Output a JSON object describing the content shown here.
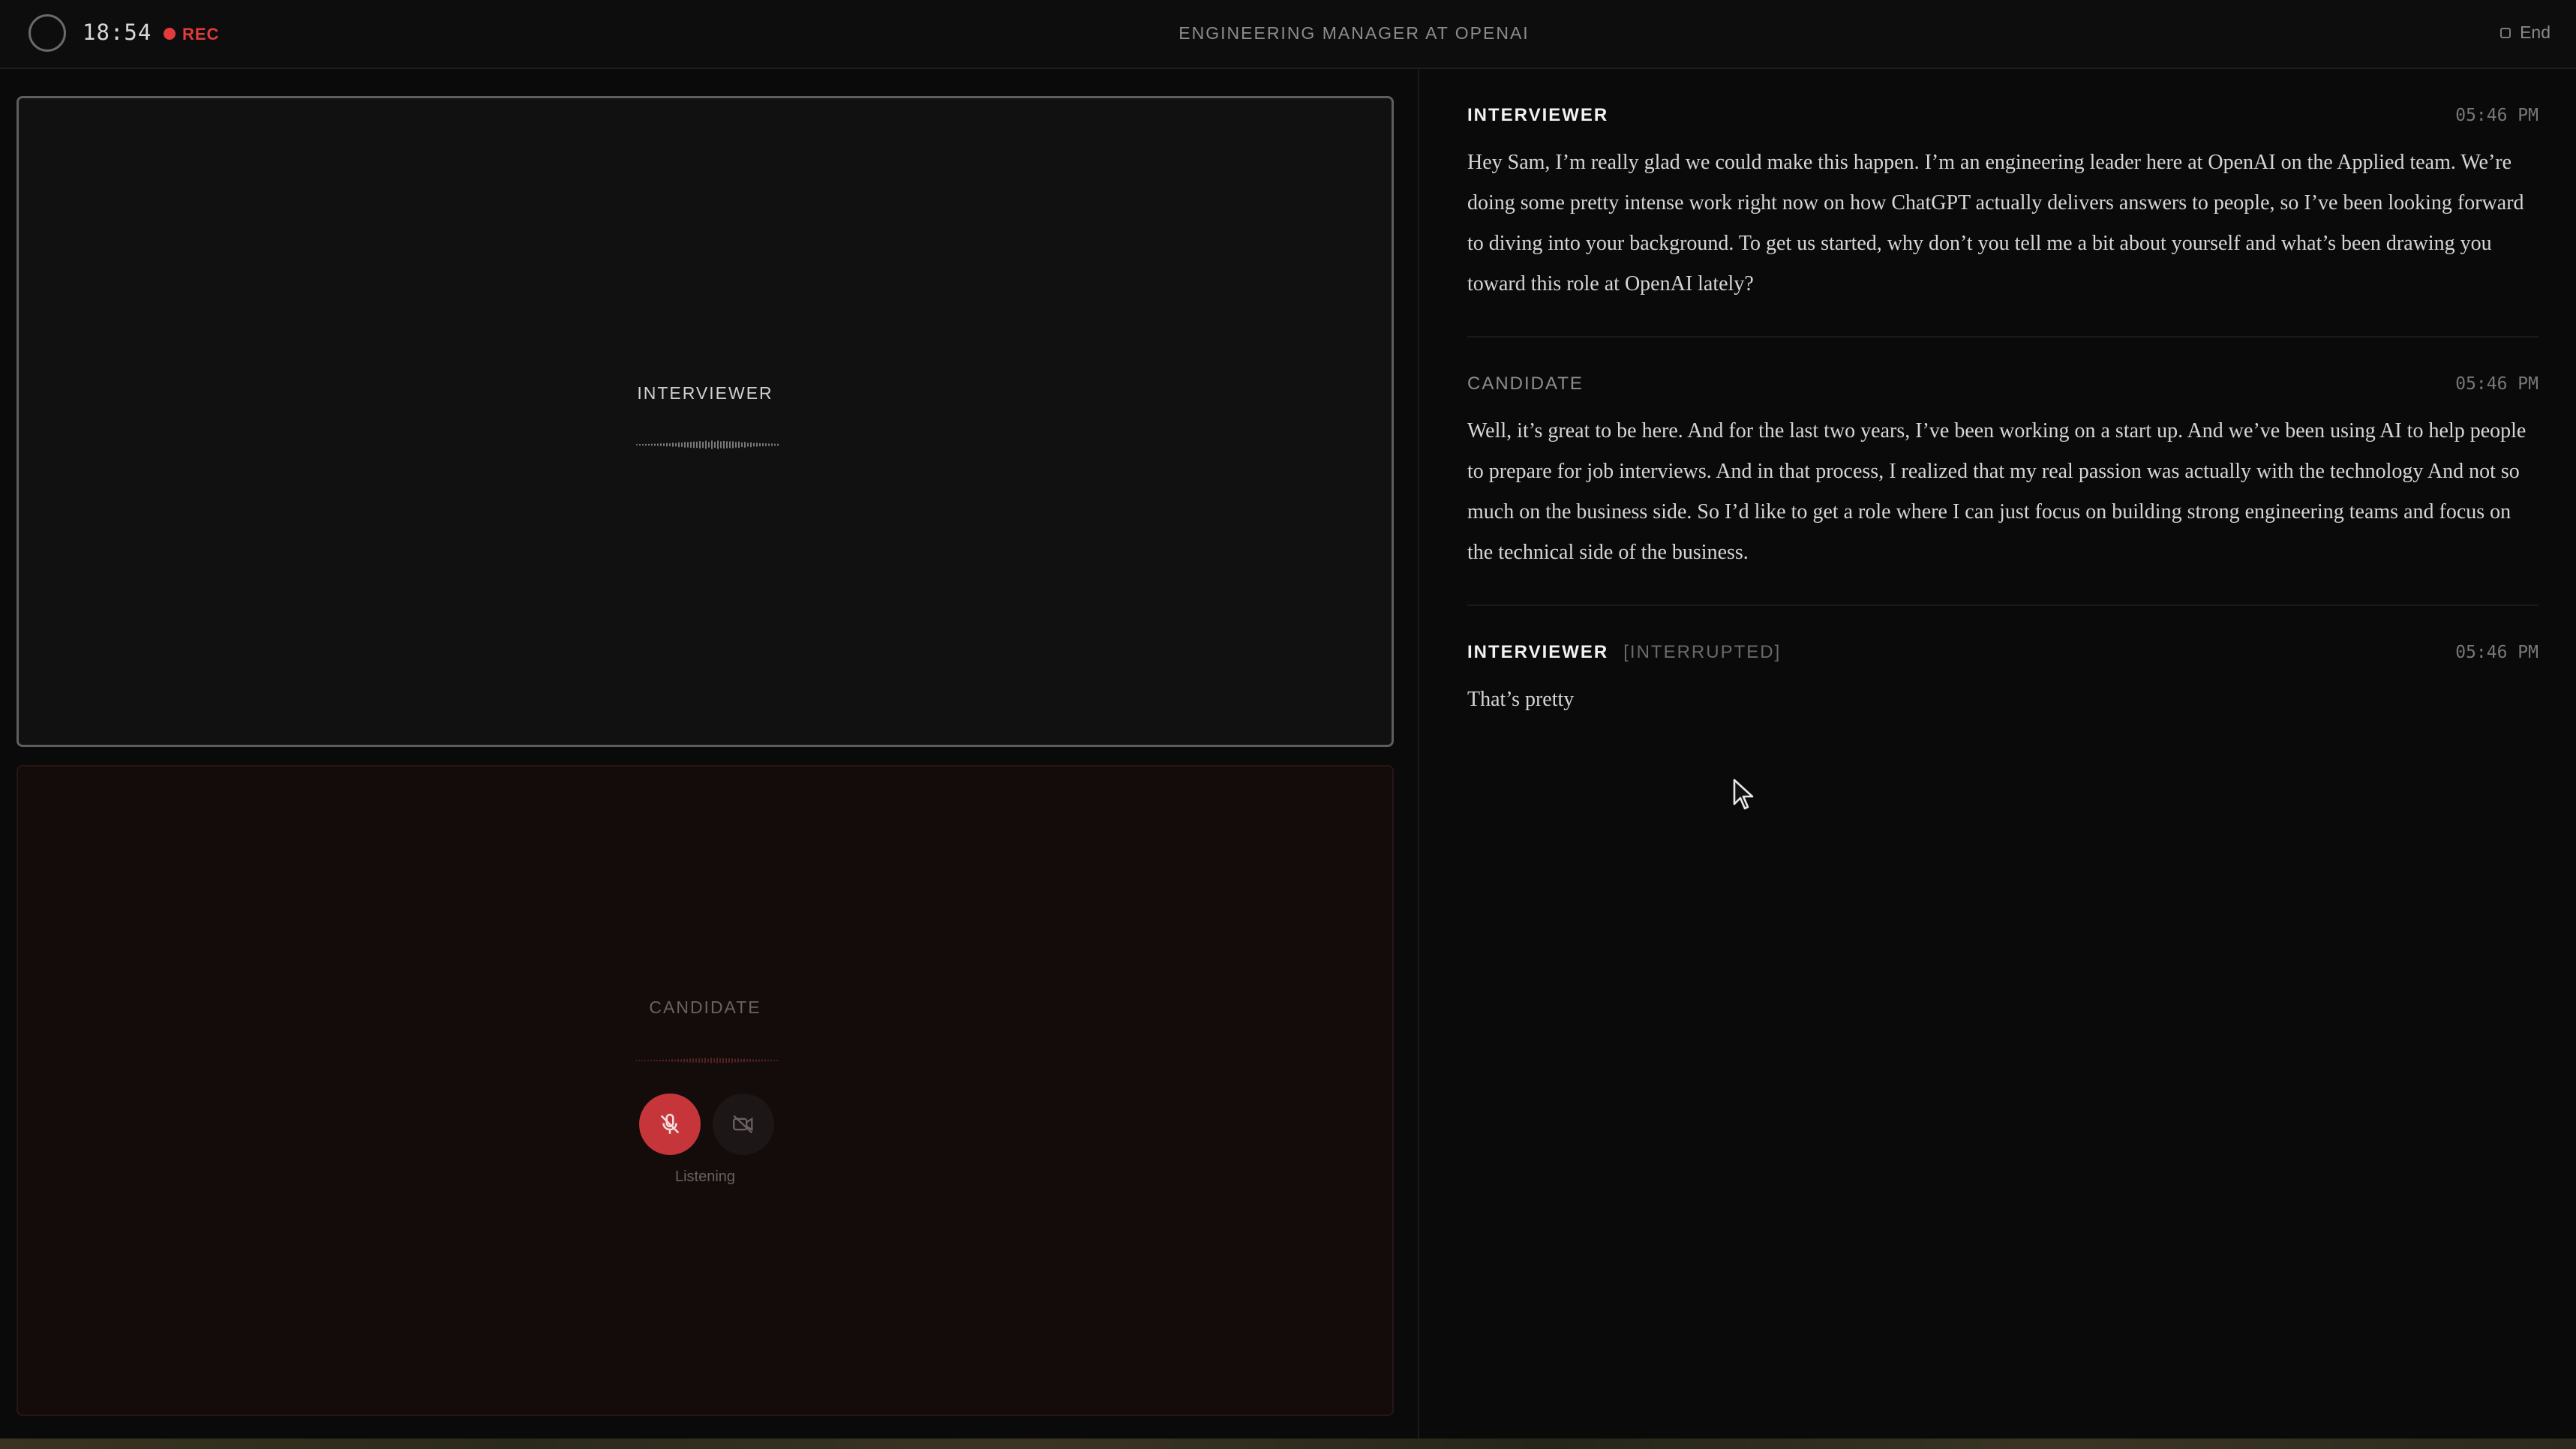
{
  "header": {
    "timer": "18:54",
    "rec_label": "REC",
    "title": "ENGINEERING MANAGER AT OPENAI",
    "end_label": "End"
  },
  "video": {
    "interviewer_label": "INTERVIEWER",
    "candidate_label": "CANDIDATE",
    "candidate_status": "Listening",
    "mic_state": "muted",
    "camera_state": "off"
  },
  "transcript": [
    {
      "speaker": "INTERVIEWER",
      "tag": "",
      "time": "05:46 PM",
      "text": "Hey Sam, I’m really glad we could make this happen. I’m an engineering leader here at OpenAI on the Applied team. We’re doing some pretty intense work right now on how ChatGPT actually delivers answers to people, so I’ve been looking forward to diving into your background. To get us started, why don’t you tell me a bit about yourself and what’s been drawing you toward this role at OpenAI lately?"
    },
    {
      "speaker": "CANDIDATE",
      "tag": "",
      "time": "05:46 PM",
      "text": "Well, it’s great to be here. And for the last two years, I’ve been working on a start up. And we’ve been using AI to help people to prepare for job interviews. And in that process, I realized that my real passion was actually with the technology And not so much on the business side. So I’d like to get a role where I can just focus on building strong engineering teams and focus on the technical side of the business."
    },
    {
      "speaker": "INTERVIEWER",
      "tag": "[INTERRUPTED]",
      "time": "05:46 PM",
      "text": "That’s pretty"
    }
  ],
  "colors": {
    "rec": "#e23b3b",
    "mic_active": "#c5353a",
    "background": "#0a0a0a"
  },
  "icons": [
    "timer-ring-icon",
    "rec-dot-icon",
    "stop-square-icon",
    "mic-off-icon",
    "camera-off-icon",
    "mouse-cursor-icon"
  ]
}
